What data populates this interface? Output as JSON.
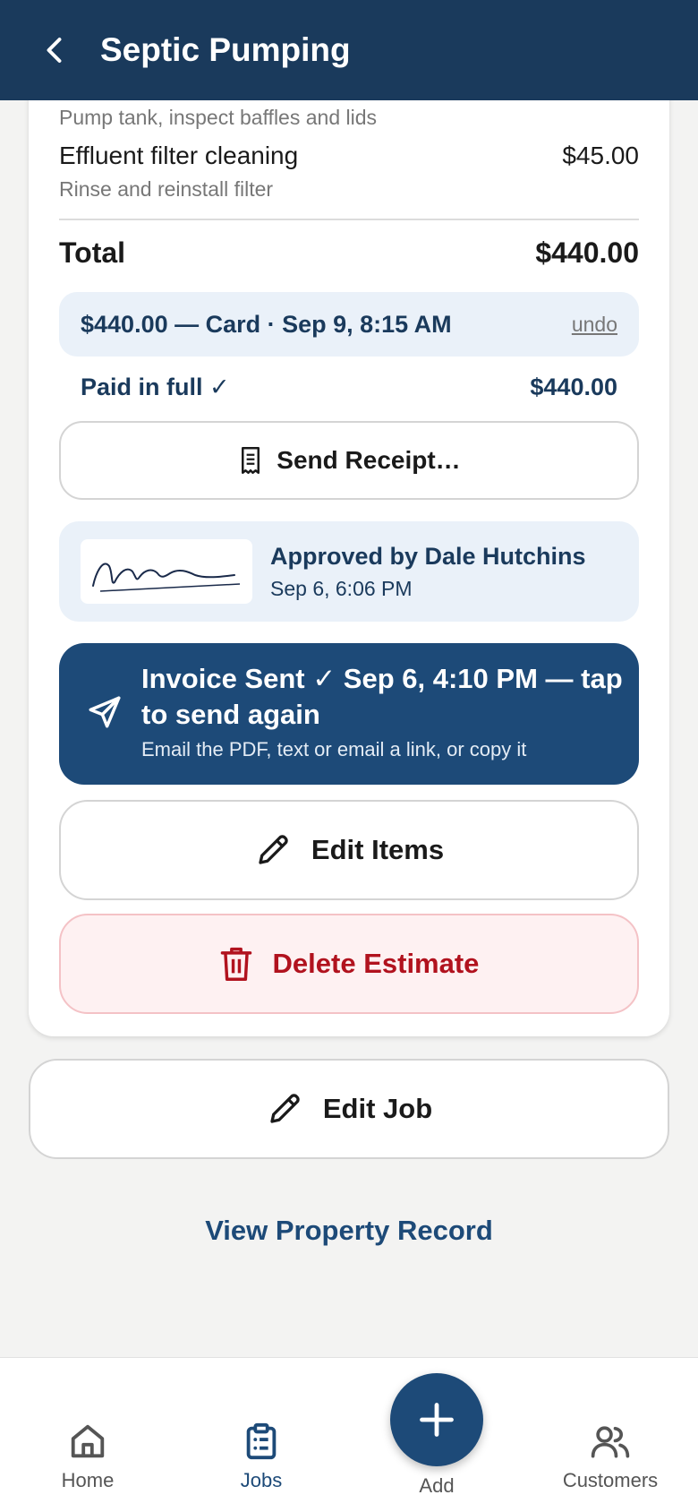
{
  "header": {
    "title": "Septic Pumping",
    "back_icon": "chevron-left-icon"
  },
  "line_items": [
    {
      "description": "Pump tank, inspect baffles and lids"
    },
    {
      "name": "Effluent filter cleaning",
      "price": "$45.00",
      "description": "Rinse and reinstall filter"
    }
  ],
  "total": {
    "label": "Total",
    "value": "$440.00"
  },
  "payment": {
    "text": "$440.00 — Card · Sep 9, 8:15 AM",
    "undo_label": "undo"
  },
  "paid": {
    "label": "Paid in full ✓",
    "value": "$440.00"
  },
  "receipt": {
    "label": "Send Receipt…",
    "icon": "receipt-icon"
  },
  "approval": {
    "title": "Approved by Dale Hutchins",
    "date": "Sep 6, 6:06 PM"
  },
  "invoice": {
    "title": "Invoice Sent ✓ Sep 6, 4:10 PM — tap to send again",
    "subtitle": "Email the PDF, text or email a link, or copy it",
    "icon": "send-icon"
  },
  "actions": {
    "edit_items": "Edit Items",
    "delete_estimate": "Delete Estimate",
    "edit_job": "Edit Job"
  },
  "property_link": "View Property Record",
  "nav": {
    "home": "Home",
    "jobs": "Jobs",
    "add": "Add",
    "customers": "Customers",
    "active": "jobs"
  },
  "colors": {
    "header_bg": "#1a3a5c",
    "accent": "#1d4a78",
    "danger": "#b1121e",
    "danger_bg": "#fef1f2",
    "info_bg": "#eaf1f9"
  }
}
